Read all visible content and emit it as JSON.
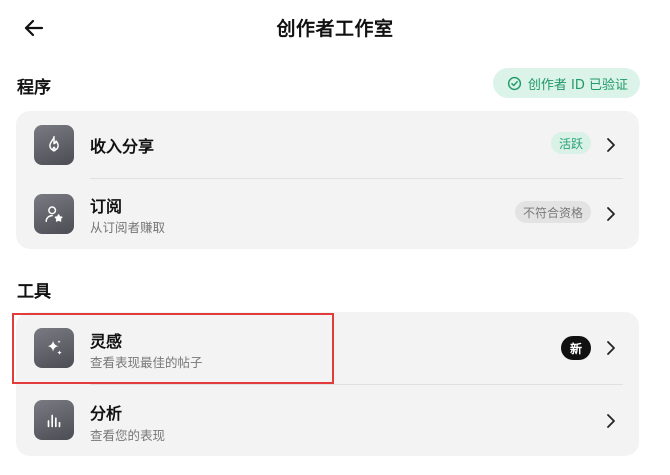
{
  "header": {
    "title": "创作者工作室",
    "back_icon": "arrow-left-icon"
  },
  "verified_badge": {
    "label": "创作者 ID 已验证",
    "icon": "check-circle-icon",
    "color": "#1f9a66",
    "background": "#dcf3ea"
  },
  "programs": {
    "title": "程序",
    "items": [
      {
        "title": "收入分享",
        "subtitle": "",
        "icon": "flame-icon",
        "badge": "活跃",
        "badge_type": "active"
      },
      {
        "title": "订阅",
        "subtitle": "从订阅者赚取",
        "icon": "user-star-icon",
        "badge": "不符合资格",
        "badge_type": "ineligible"
      }
    ]
  },
  "tools": {
    "title": "工具",
    "items": [
      {
        "title": "灵感",
        "subtitle": "查看表现最佳的帖子",
        "icon": "sparkle-icon",
        "badge": "新",
        "badge_type": "new",
        "highlighted": true
      },
      {
        "title": "分析",
        "subtitle": "查看您的表现",
        "icon": "bar-chart-icon",
        "badge": "",
        "badge_type": ""
      }
    ]
  },
  "colors": {
    "highlight": "#e33b3b",
    "card_bg": "#f3f3f3",
    "active_badge_text": "#2aa175",
    "new_badge_bg": "#111111"
  }
}
